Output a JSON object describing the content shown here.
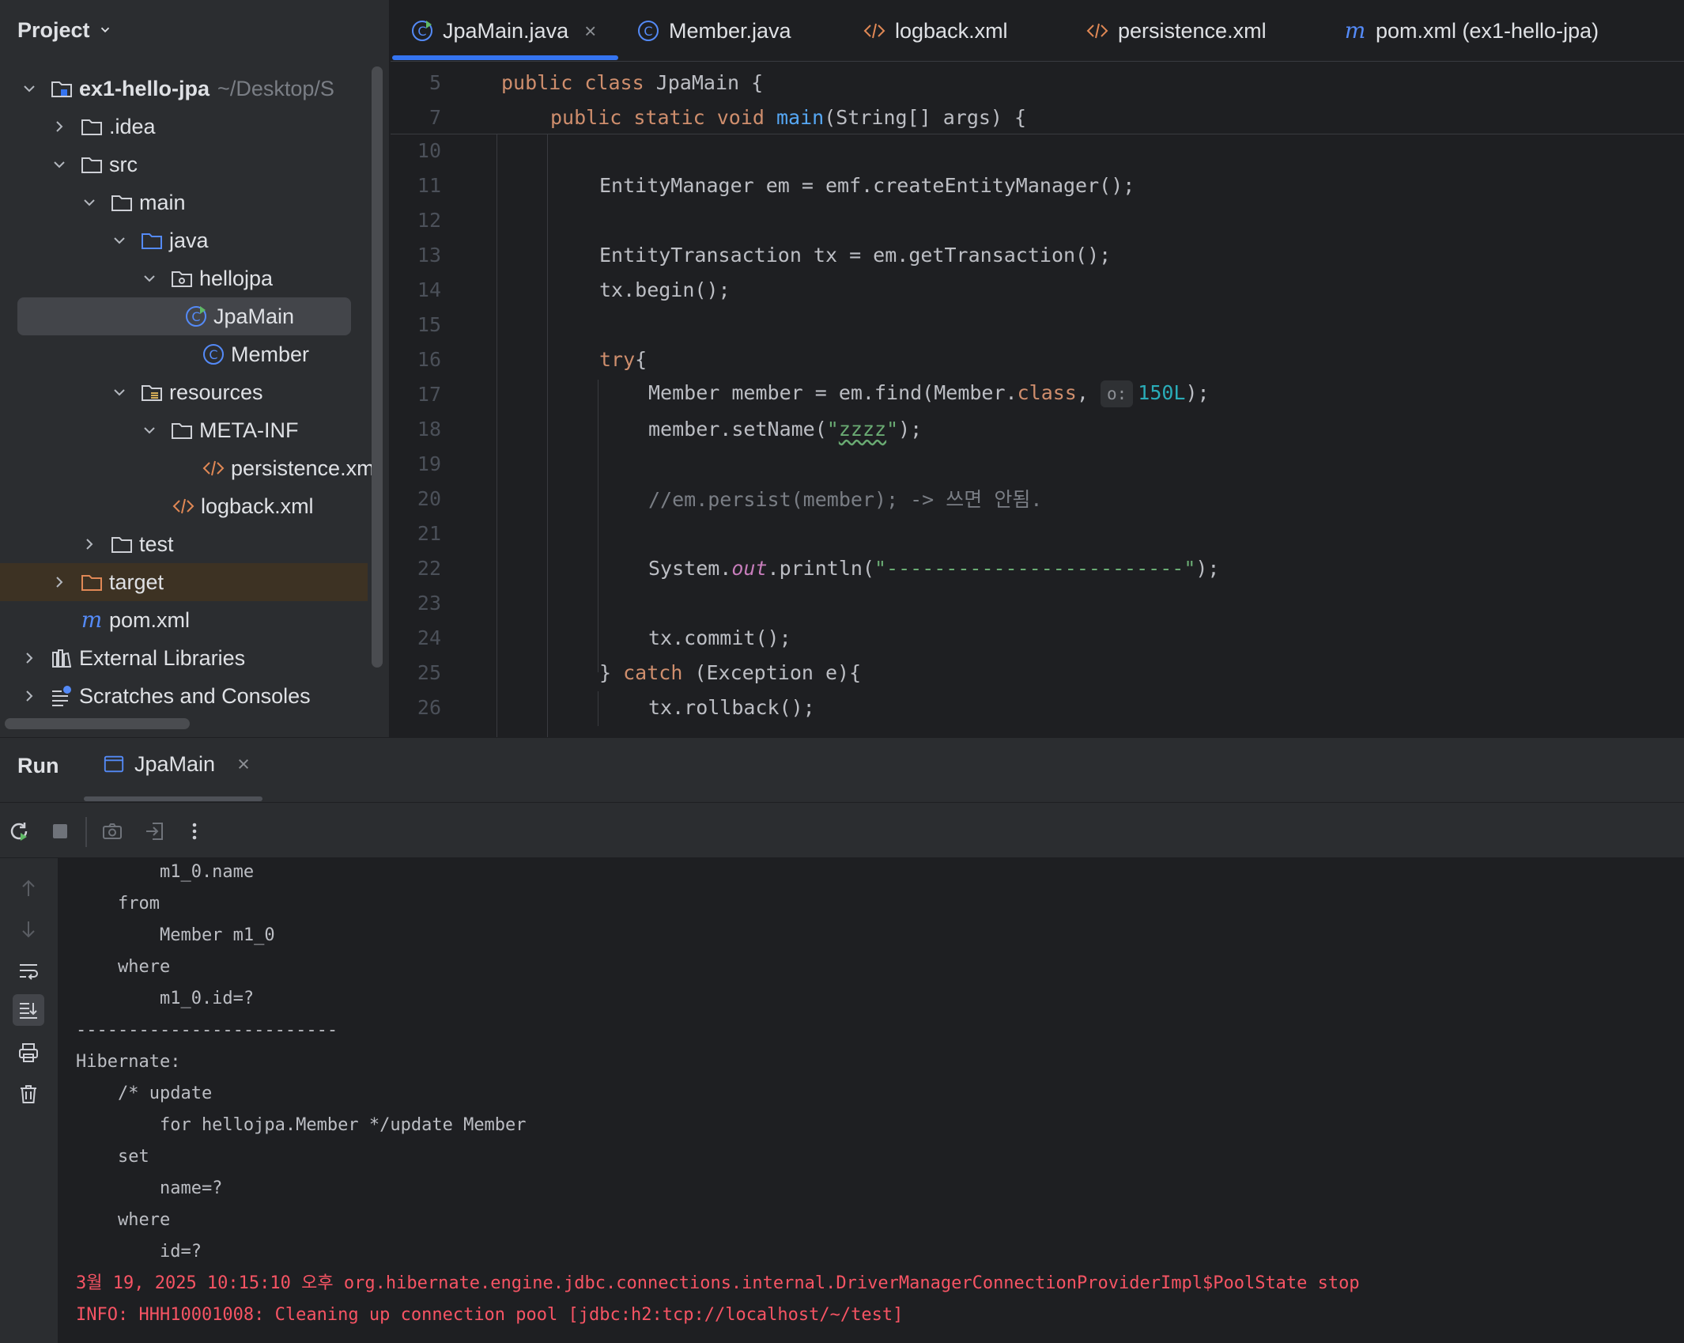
{
  "project": {
    "title": "Project",
    "items": [
      {
        "label": "ex1-hello-jpa",
        "hint": "~/Desktop/S"
      },
      {
        "label": ".idea"
      },
      {
        "label": "src"
      },
      {
        "label": "main"
      },
      {
        "label": "java"
      },
      {
        "label": "hellojpa"
      },
      {
        "label": "JpaMain"
      },
      {
        "label": "Member"
      },
      {
        "label": "resources"
      },
      {
        "label": "META-INF"
      },
      {
        "label": "persistence.xml"
      },
      {
        "label": "logback.xml"
      },
      {
        "label": "test"
      },
      {
        "label": "target"
      },
      {
        "label": "pom.xml"
      },
      {
        "label": "External Libraries"
      },
      {
        "label": "Scratches and Consoles"
      }
    ]
  },
  "tabs": [
    {
      "label": "JpaMain.java",
      "close": "×"
    },
    {
      "label": "Member.java"
    },
    {
      "label": "logback.xml"
    },
    {
      "label": "persistence.xml"
    },
    {
      "label": "pom.xml (ex1-hello-jpa)"
    }
  ],
  "editor": {
    "sticky": [
      {
        "ln": "5"
      },
      {
        "ln": "7"
      }
    ],
    "lines": [
      {
        "ln": "10"
      },
      {
        "ln": "11"
      },
      {
        "ln": "12"
      },
      {
        "ln": "13"
      },
      {
        "ln": "14"
      },
      {
        "ln": "15"
      },
      {
        "ln": "16"
      },
      {
        "ln": "17"
      },
      {
        "ln": "18"
      },
      {
        "ln": "19"
      },
      {
        "ln": "20"
      },
      {
        "ln": "21"
      },
      {
        "ln": "22"
      },
      {
        "ln": "23"
      },
      {
        "ln": "24"
      },
      {
        "ln": "25"
      },
      {
        "ln": "26"
      }
    ],
    "tokens": {
      "l5_public": "public",
      "l5_class": "class",
      "l5_rest": " JpaMain {",
      "l7_kw": "public static void ",
      "l7_fn": "main",
      "l7_rest": "(String[] args) {",
      "l11": "EntityManager em = emf.createEntityManager();",
      "l13": "EntityTransaction tx = em.getTransaction();",
      "l14": "tx.begin();",
      "l16_kw": "try",
      "l16_rest": "{",
      "l17_a": "Member member = em.find(Member.",
      "l17_kw": "class",
      "l17_b": ", ",
      "l17_hint": "o:",
      "l17_num": "150L",
      "l17_c": ");",
      "l18_a": "member.setName(",
      "l18_q1": "\"",
      "l18_str": "zzzz",
      "l18_q2": "\"",
      "l18_b": ");",
      "l20": "//em.persist(member); -> 쓰면 안됨.",
      "l22_a": "System.",
      "l22_it": "out",
      "l22_b": ".println(",
      "l22_str": "\"-------------------------\"",
      "l22_c": ");",
      "l24": "tx.commit();",
      "l25_a": "} ",
      "l25_kw": "catch",
      "l25_b": " (Exception e){",
      "l26": "tx.rollback();"
    }
  },
  "run": {
    "title": "Run",
    "tab": "JpaMain",
    "close": "×",
    "console": [
      {
        "text": "        m1_0.name",
        "type": "out"
      },
      {
        "text": "    from",
        "type": "out"
      },
      {
        "text": "        Member m1_0",
        "type": "out"
      },
      {
        "text": "    where",
        "type": "out"
      },
      {
        "text": "        m1_0.id=?",
        "type": "out"
      },
      {
        "text": "-------------------------",
        "type": "out"
      },
      {
        "text": "Hibernate: ",
        "type": "out"
      },
      {
        "text": "    /* update",
        "type": "out"
      },
      {
        "text": "        for hellojpa.Member */update Member ",
        "type": "out"
      },
      {
        "text": "    set",
        "type": "out"
      },
      {
        "text": "        name=? ",
        "type": "out"
      },
      {
        "text": "    where",
        "type": "out"
      },
      {
        "text": "        id=?",
        "type": "out"
      },
      {
        "text": "3월 19, 2025 10:15:10 오후 org.hibernate.engine.jdbc.connections.internal.DriverManagerConnectionProviderImpl$PoolState stop",
        "type": "err"
      },
      {
        "text": "INFO: HHH10001008: Cleaning up connection pool [jdbc:h2:tcp://localhost/~/test]",
        "type": "err"
      }
    ]
  },
  "colors": {
    "accent": "#3574f0",
    "keyword": "#cf8e6d",
    "function": "#56a8f5",
    "string": "#6aab73",
    "number": "#2aacb8",
    "error": "#f75464"
  }
}
